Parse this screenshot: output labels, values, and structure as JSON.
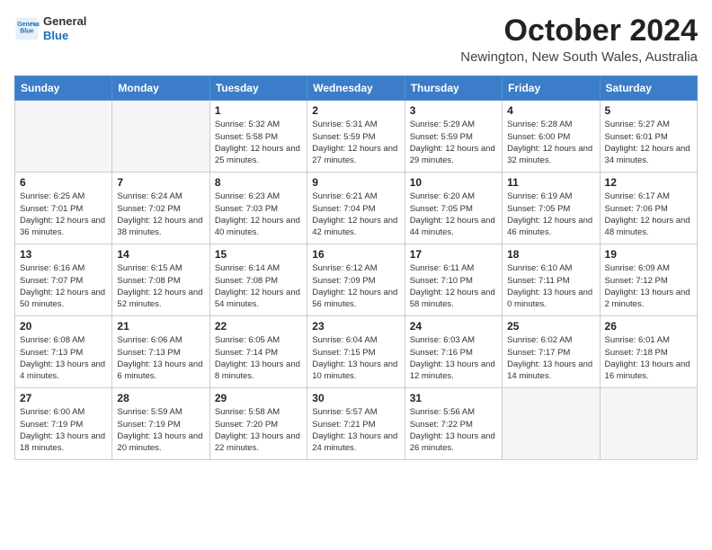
{
  "header": {
    "logo_line1": "General",
    "logo_line2": "Blue",
    "month": "October 2024",
    "location": "Newington, New South Wales, Australia"
  },
  "days_of_week": [
    "Sunday",
    "Monday",
    "Tuesday",
    "Wednesday",
    "Thursday",
    "Friday",
    "Saturday"
  ],
  "weeks": [
    [
      {
        "day": "",
        "empty": true
      },
      {
        "day": "",
        "empty": true
      },
      {
        "day": "1",
        "sunrise": "Sunrise: 5:32 AM",
        "sunset": "Sunset: 5:58 PM",
        "daylight": "Daylight: 12 hours and 25 minutes."
      },
      {
        "day": "2",
        "sunrise": "Sunrise: 5:31 AM",
        "sunset": "Sunset: 5:59 PM",
        "daylight": "Daylight: 12 hours and 27 minutes."
      },
      {
        "day": "3",
        "sunrise": "Sunrise: 5:29 AM",
        "sunset": "Sunset: 5:59 PM",
        "daylight": "Daylight: 12 hours and 29 minutes."
      },
      {
        "day": "4",
        "sunrise": "Sunrise: 5:28 AM",
        "sunset": "Sunset: 6:00 PM",
        "daylight": "Daylight: 12 hours and 32 minutes."
      },
      {
        "day": "5",
        "sunrise": "Sunrise: 5:27 AM",
        "sunset": "Sunset: 6:01 PM",
        "daylight": "Daylight: 12 hours and 34 minutes."
      }
    ],
    [
      {
        "day": "6",
        "sunrise": "Sunrise: 6:25 AM",
        "sunset": "Sunset: 7:01 PM",
        "daylight": "Daylight: 12 hours and 36 minutes."
      },
      {
        "day": "7",
        "sunrise": "Sunrise: 6:24 AM",
        "sunset": "Sunset: 7:02 PM",
        "daylight": "Daylight: 12 hours and 38 minutes."
      },
      {
        "day": "8",
        "sunrise": "Sunrise: 6:23 AM",
        "sunset": "Sunset: 7:03 PM",
        "daylight": "Daylight: 12 hours and 40 minutes."
      },
      {
        "day": "9",
        "sunrise": "Sunrise: 6:21 AM",
        "sunset": "Sunset: 7:04 PM",
        "daylight": "Daylight: 12 hours and 42 minutes."
      },
      {
        "day": "10",
        "sunrise": "Sunrise: 6:20 AM",
        "sunset": "Sunset: 7:05 PM",
        "daylight": "Daylight: 12 hours and 44 minutes."
      },
      {
        "day": "11",
        "sunrise": "Sunrise: 6:19 AM",
        "sunset": "Sunset: 7:05 PM",
        "daylight": "Daylight: 12 hours and 46 minutes."
      },
      {
        "day": "12",
        "sunrise": "Sunrise: 6:17 AM",
        "sunset": "Sunset: 7:06 PM",
        "daylight": "Daylight: 12 hours and 48 minutes."
      }
    ],
    [
      {
        "day": "13",
        "sunrise": "Sunrise: 6:16 AM",
        "sunset": "Sunset: 7:07 PM",
        "daylight": "Daylight: 12 hours and 50 minutes."
      },
      {
        "day": "14",
        "sunrise": "Sunrise: 6:15 AM",
        "sunset": "Sunset: 7:08 PM",
        "daylight": "Daylight: 12 hours and 52 minutes."
      },
      {
        "day": "15",
        "sunrise": "Sunrise: 6:14 AM",
        "sunset": "Sunset: 7:08 PM",
        "daylight": "Daylight: 12 hours and 54 minutes."
      },
      {
        "day": "16",
        "sunrise": "Sunrise: 6:12 AM",
        "sunset": "Sunset: 7:09 PM",
        "daylight": "Daylight: 12 hours and 56 minutes."
      },
      {
        "day": "17",
        "sunrise": "Sunrise: 6:11 AM",
        "sunset": "Sunset: 7:10 PM",
        "daylight": "Daylight: 12 hours and 58 minutes."
      },
      {
        "day": "18",
        "sunrise": "Sunrise: 6:10 AM",
        "sunset": "Sunset: 7:11 PM",
        "daylight": "Daylight: 13 hours and 0 minutes."
      },
      {
        "day": "19",
        "sunrise": "Sunrise: 6:09 AM",
        "sunset": "Sunset: 7:12 PM",
        "daylight": "Daylight: 13 hours and 2 minutes."
      }
    ],
    [
      {
        "day": "20",
        "sunrise": "Sunrise: 6:08 AM",
        "sunset": "Sunset: 7:13 PM",
        "daylight": "Daylight: 13 hours and 4 minutes."
      },
      {
        "day": "21",
        "sunrise": "Sunrise: 6:06 AM",
        "sunset": "Sunset: 7:13 PM",
        "daylight": "Daylight: 13 hours and 6 minutes."
      },
      {
        "day": "22",
        "sunrise": "Sunrise: 6:05 AM",
        "sunset": "Sunset: 7:14 PM",
        "daylight": "Daylight: 13 hours and 8 minutes."
      },
      {
        "day": "23",
        "sunrise": "Sunrise: 6:04 AM",
        "sunset": "Sunset: 7:15 PM",
        "daylight": "Daylight: 13 hours and 10 minutes."
      },
      {
        "day": "24",
        "sunrise": "Sunrise: 6:03 AM",
        "sunset": "Sunset: 7:16 PM",
        "daylight": "Daylight: 13 hours and 12 minutes."
      },
      {
        "day": "25",
        "sunrise": "Sunrise: 6:02 AM",
        "sunset": "Sunset: 7:17 PM",
        "daylight": "Daylight: 13 hours and 14 minutes."
      },
      {
        "day": "26",
        "sunrise": "Sunrise: 6:01 AM",
        "sunset": "Sunset: 7:18 PM",
        "daylight": "Daylight: 13 hours and 16 minutes."
      }
    ],
    [
      {
        "day": "27",
        "sunrise": "Sunrise: 6:00 AM",
        "sunset": "Sunset: 7:19 PM",
        "daylight": "Daylight: 13 hours and 18 minutes."
      },
      {
        "day": "28",
        "sunrise": "Sunrise: 5:59 AM",
        "sunset": "Sunset: 7:19 PM",
        "daylight": "Daylight: 13 hours and 20 minutes."
      },
      {
        "day": "29",
        "sunrise": "Sunrise: 5:58 AM",
        "sunset": "Sunset: 7:20 PM",
        "daylight": "Daylight: 13 hours and 22 minutes."
      },
      {
        "day": "30",
        "sunrise": "Sunrise: 5:57 AM",
        "sunset": "Sunset: 7:21 PM",
        "daylight": "Daylight: 13 hours and 24 minutes."
      },
      {
        "day": "31",
        "sunrise": "Sunrise: 5:56 AM",
        "sunset": "Sunset: 7:22 PM",
        "daylight": "Daylight: 13 hours and 26 minutes."
      },
      {
        "day": "",
        "empty": true
      },
      {
        "day": "",
        "empty": true
      }
    ]
  ]
}
